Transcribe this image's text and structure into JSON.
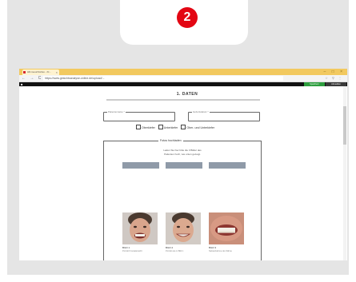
{
  "step": {
    "number": "2",
    "color": "#e30613"
  },
  "browser": {
    "tab_title": "HR-Gesichtsfoto - Kl...",
    "tab_close": "×",
    "window_controls": "– □ ×",
    "nav": "← → C ⌂",
    "url": "https://www.gesichtsanalyse-online.de/upload/...",
    "toolbar_icons": "☆ ⚲ ⋮"
  },
  "app": {
    "logo": "■",
    "button_green": "Speichern",
    "button_dark": "Abmelden"
  },
  "form": {
    "title": "1. DATEN",
    "field_first_label": "Patientenname *",
    "field_second_label": "Geburtsdatum *",
    "checkboxes": [
      "Oberkiefer",
      "Unterkiefer",
      "Ober- und Unterkiefer"
    ],
    "panel_title": "Fotos hochladen",
    "instruction_line1": "Laden Sie hier bitte die 3 Bilder des",
    "instruction_line2": "Patienten hoch, wie unten gezeigt.",
    "photos": [
      {
        "caption": "BILD 1",
        "sub": "Porträt Frontalansicht"
      },
      {
        "caption": "BILD 2",
        "sub": "Porträt wie in Bild 1"
      },
      {
        "caption": "BILD 3",
        "sub": "Nahaufnahme der Zähne"
      }
    ]
  },
  "colors": {
    "frame": "#e5e5e5",
    "titlebar": "#f2c95f",
    "upload_button": "#8f9aa8"
  }
}
